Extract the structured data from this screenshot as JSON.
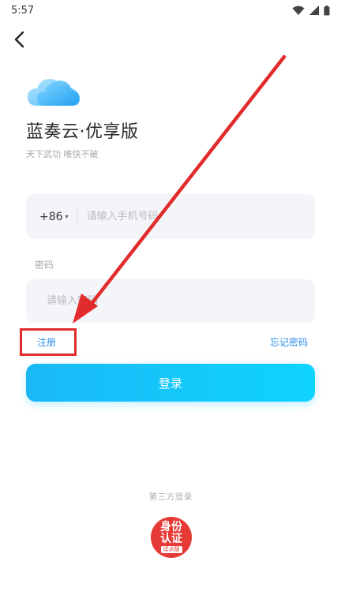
{
  "status_bar": {
    "time": "5:57"
  },
  "app": {
    "title": "蓝奏云·优享版",
    "subtitle": "天下武功 唯快不破"
  },
  "login_form": {
    "country_code": "+86",
    "phone_placeholder": "请输入手机号码",
    "password_label": "密码",
    "password_placeholder": "请输入密码",
    "register_label": "注册",
    "forgot_password_label": "忘记密码",
    "login_button_label": "登录"
  },
  "third_party": {
    "title": "第三方登录",
    "badge_line1": "身份",
    "badge_line2": "认证",
    "badge_line3": "试点版"
  },
  "icons": {
    "back": "back-arrow-icon",
    "wifi": "wifi-icon",
    "signal": "signal-icon",
    "battery": "battery-icon",
    "logo": "cloud-logo-icon"
  },
  "colors": {
    "accent": "#1ab9f6",
    "link": "#2a8fe8",
    "annotation": "#e22b2b",
    "badge": "#e53a35"
  }
}
